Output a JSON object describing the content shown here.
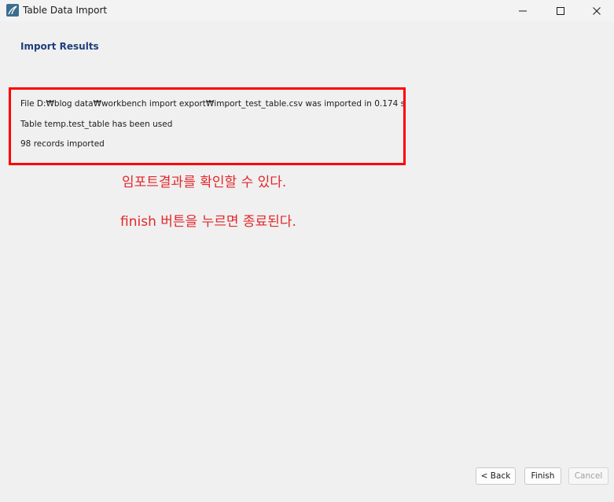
{
  "window": {
    "title": "Table Data Import",
    "app_icon": "mysql-workbench-icon",
    "controls": [
      "minimize-icon",
      "maximize-icon",
      "close-icon"
    ]
  },
  "page": {
    "section_title": "Import Results"
  },
  "results": {
    "lines": [
      "File D:₩blog data₩workbench import export₩import_test_table.csv was imported in 0.174 s",
      "Table temp.test_table has been used",
      "98 records imported"
    ]
  },
  "annotations": {
    "note1": "임포트결과를 확인할 수 있다.",
    "note2": "finish 버튼을 누르면 종료된다.",
    "color": "#e3262a",
    "box_color": "#ff0000"
  },
  "buttons": {
    "back": "< Back",
    "finish": "Finish",
    "cancel": "Cancel"
  }
}
